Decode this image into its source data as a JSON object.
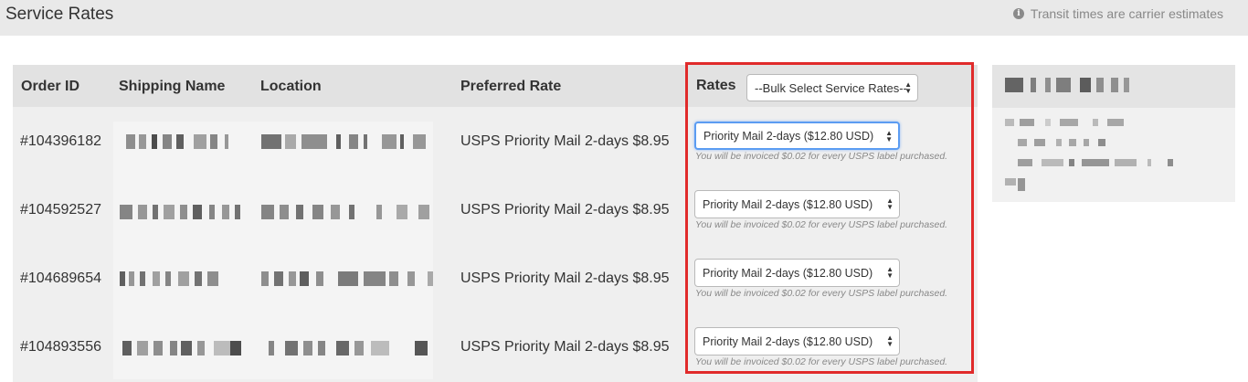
{
  "header": {
    "title": "Service Rates",
    "notice": "Transit times are carrier estimates",
    "notice_icon": "info-icon"
  },
  "table": {
    "columns": [
      "Order ID",
      "Shipping Name",
      "Location",
      "Preferred Rate"
    ],
    "rows": [
      {
        "order_id": "#104396182",
        "preferred_rate": "USPS Priority Mail 2-days $8.95",
        "selected_rate": "Priority Mail 2-days ($12.80 USD)",
        "note": "You will be invoiced $0.02 for every USPS label purchased."
      },
      {
        "order_id": "#104592527",
        "preferred_rate": "USPS Priority Mail 2-days $8.95",
        "selected_rate": "Priority Mail 2-days ($12.80 USD)",
        "note": "You will be invoiced $0.02 for every USPS label purchased."
      },
      {
        "order_id": "#104689654",
        "preferred_rate": "USPS Priority Mail 2-days $8.95",
        "selected_rate": "Priority Mail 2-days ($12.80 USD)",
        "note": "You will be invoiced $0.02 for every USPS label purchased."
      },
      {
        "order_id": "#104893556",
        "preferred_rate": "USPS Priority Mail 2-days $8.95",
        "selected_rate": "Priority Mail 2-days ($12.80 USD)",
        "note": "You will be invoiced $0.02 for every USPS label purchased."
      }
    ]
  },
  "rates": {
    "title": "Rates",
    "bulk_select": "--Bulk Select Service Rates--"
  },
  "colors": {
    "highlight_border": "#e02b2b",
    "focus_border": "#5b9cf2"
  }
}
